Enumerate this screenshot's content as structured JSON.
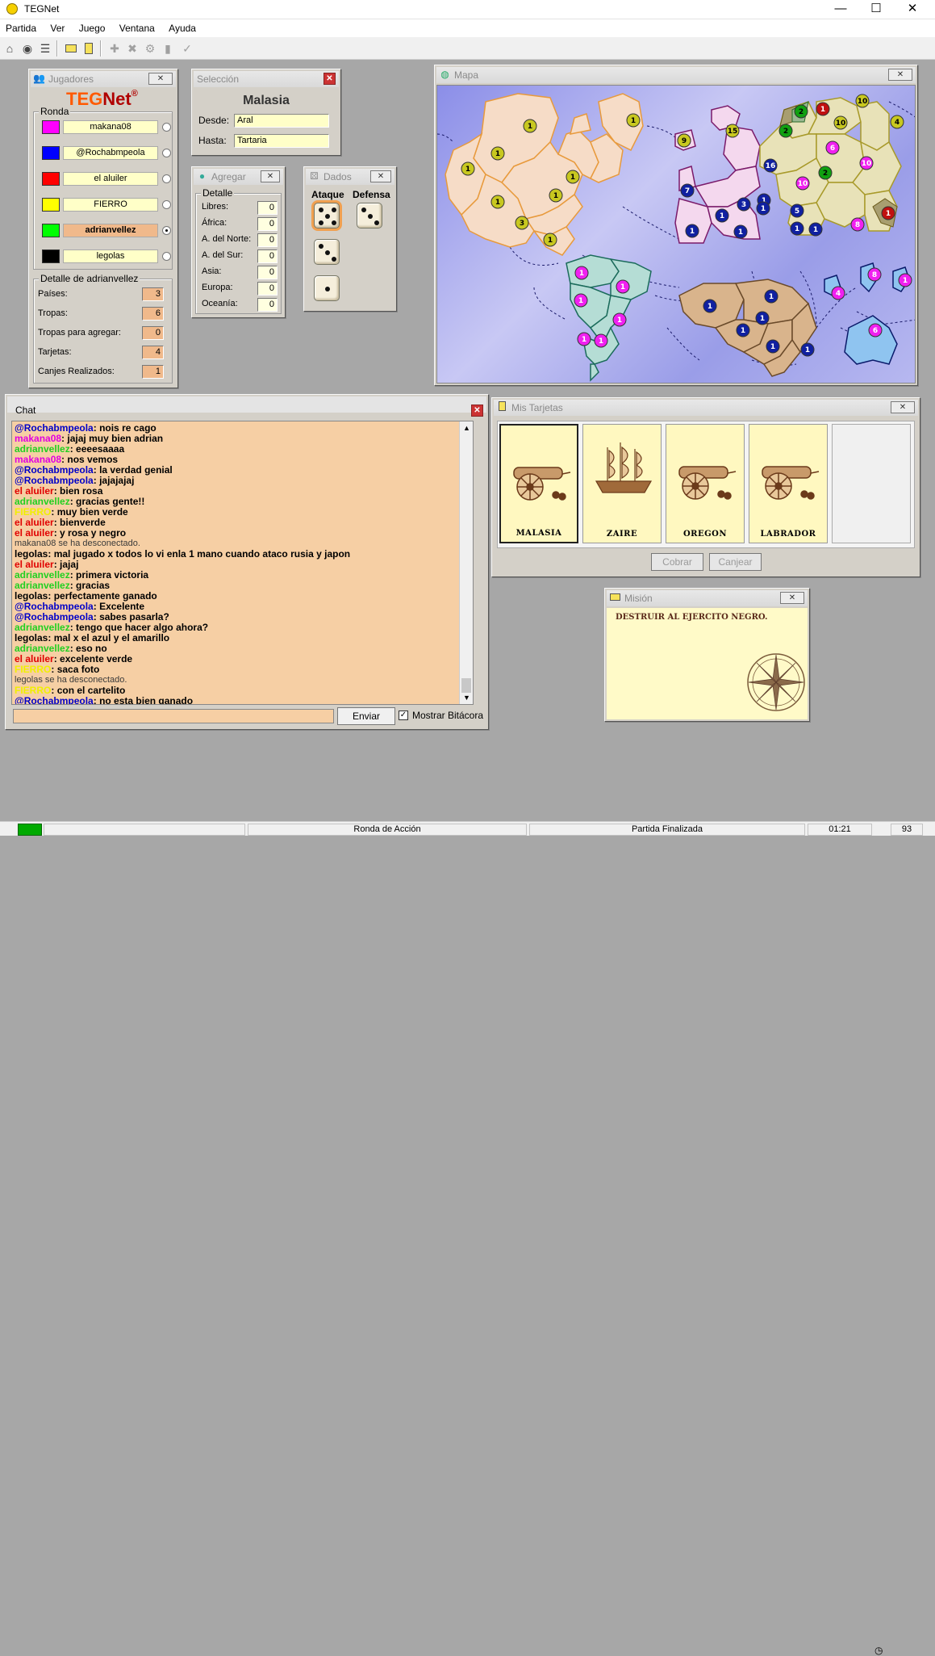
{
  "window": {
    "title": "TEGNet",
    "minimize": "—",
    "maximize": "☐",
    "close": "✕"
  },
  "menu": [
    "Partida",
    "Ver",
    "Juego",
    "Ventana",
    "Ayuda"
  ],
  "colors": {
    "magenta": "#ff00ff",
    "blue": "#0000ff",
    "red": "#ff0000",
    "yellow": "#ffff00",
    "green": "#00ff00",
    "black": "#000000"
  },
  "players_panel": {
    "title": "Jugadores",
    "logo_teg": "TEG",
    "logo_net": "Net",
    "logo_reg": "®",
    "round_label": "Ronda",
    "players": [
      {
        "name": "makana08",
        "color": "#ff00ff",
        "active": false
      },
      {
        "name": "@Rochabmpeola",
        "color": "#0000ff",
        "active": false
      },
      {
        "name": "el aluiler",
        "color": "#ff0000",
        "active": false
      },
      {
        "name": "FIERRO",
        "color": "#ffff00",
        "active": false
      },
      {
        "name": "adrianvellez",
        "color": "#00ff00",
        "active": true
      },
      {
        "name": "legolas",
        "color": "#000000",
        "active": false
      }
    ],
    "detail_label": "Detalle de adrianvellez",
    "details": [
      {
        "label": "Países:",
        "value": "3"
      },
      {
        "label": "Tropas:",
        "value": "6"
      },
      {
        "label": "Tropas para agregar:",
        "value": "0"
      },
      {
        "label": "Tarjetas:",
        "value": "4"
      },
      {
        "label": "Canjes Realizados:",
        "value": "1"
      }
    ]
  },
  "selection_panel": {
    "title": "Selección",
    "country": "Malasia",
    "from_label": "Desde:",
    "from_value": "Aral",
    "to_label": "Hasta:",
    "to_value": "Tartaria"
  },
  "add_panel": {
    "title": "Agregar",
    "detail_label": "Detalle",
    "rows": [
      {
        "label": "Libres:",
        "value": "0"
      },
      {
        "label": "África:",
        "value": "0"
      },
      {
        "label": "A. del Norte:",
        "value": "0"
      },
      {
        "label": "A. del Sur:",
        "value": "0"
      },
      {
        "label": "Asia:",
        "value": "0"
      },
      {
        "label": "Europa:",
        "value": "0"
      },
      {
        "label": "Oceanía:",
        "value": "0"
      }
    ]
  },
  "dice_panel": {
    "title": "Dados",
    "attack_label": "Ataque",
    "defense_label": "Defensa",
    "attack": [
      5,
      3,
      1
    ],
    "defense": [
      3
    ]
  },
  "map_panel": {
    "title": "Mapa",
    "armies": [
      {
        "n": "1",
        "owner": "yellow"
      },
      {
        "n": "1",
        "owner": "yellow"
      },
      {
        "n": "1",
        "owner": "yellow"
      },
      {
        "n": "1",
        "owner": "yellow"
      },
      {
        "n": "1",
        "owner": "yellow"
      },
      {
        "n": "1",
        "owner": "yellow"
      },
      {
        "n": "1",
        "owner": "yellow"
      },
      {
        "n": "3",
        "owner": "yellow"
      },
      {
        "n": "1",
        "owner": "yellow"
      },
      {
        "n": "1",
        "owner": "yellow"
      },
      {
        "n": "1",
        "owner": "magenta"
      },
      {
        "n": "1",
        "owner": "magenta"
      },
      {
        "n": "1",
        "owner": "magenta"
      },
      {
        "n": "1",
        "owner": "magenta"
      },
      {
        "n": "1",
        "owner": "magenta"
      },
      {
        "n": "1",
        "owner": "magenta"
      },
      {
        "n": "9",
        "owner": "yellow"
      },
      {
        "n": "15",
        "owner": "yellow"
      },
      {
        "n": "7",
        "owner": "blue"
      },
      {
        "n": "16",
        "owner": "blue"
      },
      {
        "n": "1",
        "owner": "blue"
      },
      {
        "n": "3",
        "owner": "blue"
      },
      {
        "n": "1",
        "owner": "blue"
      },
      {
        "n": "1",
        "owner": "blue"
      },
      {
        "n": "1",
        "owner": "blue"
      },
      {
        "n": "1",
        "owner": "blue"
      },
      {
        "n": "2",
        "owner": "green"
      },
      {
        "n": "1",
        "owner": "red"
      },
      {
        "n": "10",
        "owner": "yellow"
      },
      {
        "n": "4",
        "owner": "yellow"
      },
      {
        "n": "2",
        "owner": "green"
      },
      {
        "n": "10",
        "owner": "yellow"
      },
      {
        "n": "6",
        "owner": "magenta"
      },
      {
        "n": "2",
        "owner": "green"
      },
      {
        "n": "10",
        "owner": "magenta"
      },
      {
        "n": "10",
        "owner": "magenta"
      },
      {
        "n": "5",
        "owner": "blue"
      },
      {
        "n": "1",
        "owner": "blue"
      },
      {
        "n": "1",
        "owner": "blue"
      },
      {
        "n": "8",
        "owner": "magenta"
      },
      {
        "n": "1",
        "owner": "red"
      },
      {
        "n": "1",
        "owner": "blue"
      },
      {
        "n": "1",
        "owner": "blue"
      },
      {
        "n": "1",
        "owner": "blue"
      },
      {
        "n": "1",
        "owner": "blue"
      },
      {
        "n": "1",
        "owner": "blue"
      },
      {
        "n": "1",
        "owner": "blue"
      },
      {
        "n": "4",
        "owner": "magenta"
      },
      {
        "n": "8",
        "owner": "magenta"
      },
      {
        "n": "1",
        "owner": "magenta"
      },
      {
        "n": "6",
        "owner": "magenta"
      }
    ]
  },
  "chat": {
    "title": "Chat",
    "messages": [
      {
        "user": "@Rochabmpeola",
        "color": "#0000c8",
        "text": "nois re cago"
      },
      {
        "user": "makana08",
        "color": "#e000e0",
        "text": "jajaj muy bien adrian"
      },
      {
        "user": "adrianvellez",
        "color": "#20d020",
        "text": "eeeesaaaa"
      },
      {
        "user": "makana08",
        "color": "#e000e0",
        "text": "nos vemos"
      },
      {
        "user": "@Rochabmpeola",
        "color": "#0000c8",
        "text": "la verdad genial"
      },
      {
        "user": "@Rochabmpeola",
        "color": "#0000c8",
        "text": "jajajajaj"
      },
      {
        "user": "el aluiler",
        "color": "#e00000",
        "text": "bien rosa"
      },
      {
        "user": "adrianvellez",
        "color": "#20d020",
        "text": "gracias gente!!"
      },
      {
        "user": "FIERRO",
        "color": "#f0f000",
        "text": "muy bien verde"
      },
      {
        "user": "el aluiler",
        "color": "#e00000",
        "text": "bienverde"
      },
      {
        "user": "el aluiler",
        "color": "#e00000",
        "text": "y rosa y negro"
      },
      {
        "system": "makana08 se ha desconectado."
      },
      {
        "user": "legolas",
        "color": "#000000",
        "text": "mal jugado x todos lo vi enla 1 mano cuando ataco rusia y japon"
      },
      {
        "user": "el aluiler",
        "color": "#e00000",
        "text": "jajaj"
      },
      {
        "user": "adrianvellez",
        "color": "#20d020",
        "text": "primera victoria"
      },
      {
        "user": "adrianvellez",
        "color": "#20d020",
        "text": "gracias"
      },
      {
        "user": "legolas",
        "color": "#000000",
        "text": "perfectamente ganado"
      },
      {
        "user": "@Rochabmpeola",
        "color": "#0000c8",
        "text": "Excelente"
      },
      {
        "user": "@Rochabmpeola",
        "color": "#0000c8",
        "text": "sabes pasarla?"
      },
      {
        "user": "adrianvellez",
        "color": "#20d020",
        "text": "tengo que hacer algo ahora?"
      },
      {
        "user": "legolas",
        "color": "#000000",
        "text": "mal x el azul y el amarillo"
      },
      {
        "user": "adrianvellez",
        "color": "#20d020",
        "text": "eso no"
      },
      {
        "user": "el aluiler",
        "color": "#e00000",
        "text": "excelente verde"
      },
      {
        "user": "FIERRO",
        "color": "#f0f000",
        "text": "saca foto"
      },
      {
        "system": "legolas se ha desconectado."
      },
      {
        "user": "FIERRO",
        "color": "#f0f000",
        "text": "con el cartelito"
      },
      {
        "user": "@Rochabmpeola",
        "color": "#0000c8",
        "text": "no esta bien ganado"
      }
    ],
    "input_value": "",
    "send_label": "Enviar",
    "log_checkbox_label": "Mostrar Bitácora",
    "log_checked": true
  },
  "cards_panel": {
    "title": "Mis Tarjetas",
    "cards": [
      {
        "name": "MALASIA",
        "symbol": "cannon-icon",
        "selected": true
      },
      {
        "name": "ZAIRE",
        "symbol": "ship-icon",
        "selected": false
      },
      {
        "name": "OREGON",
        "symbol": "cannon-icon",
        "selected": false
      },
      {
        "name": "LABRADOR",
        "symbol": "cannon-icon",
        "selected": false
      },
      {
        "name": "",
        "symbol": "",
        "selected": false
      }
    ],
    "collect_label": "Cobrar",
    "exchange_label": "Canjear"
  },
  "mission_panel": {
    "title": "Misión",
    "text": "DESTRUIR AL EJERCITO NEGRO."
  },
  "status": {
    "phase": "Ronda de Acción",
    "game_state": "Partida Finalizada",
    "time": "01:21",
    "number": "93"
  }
}
